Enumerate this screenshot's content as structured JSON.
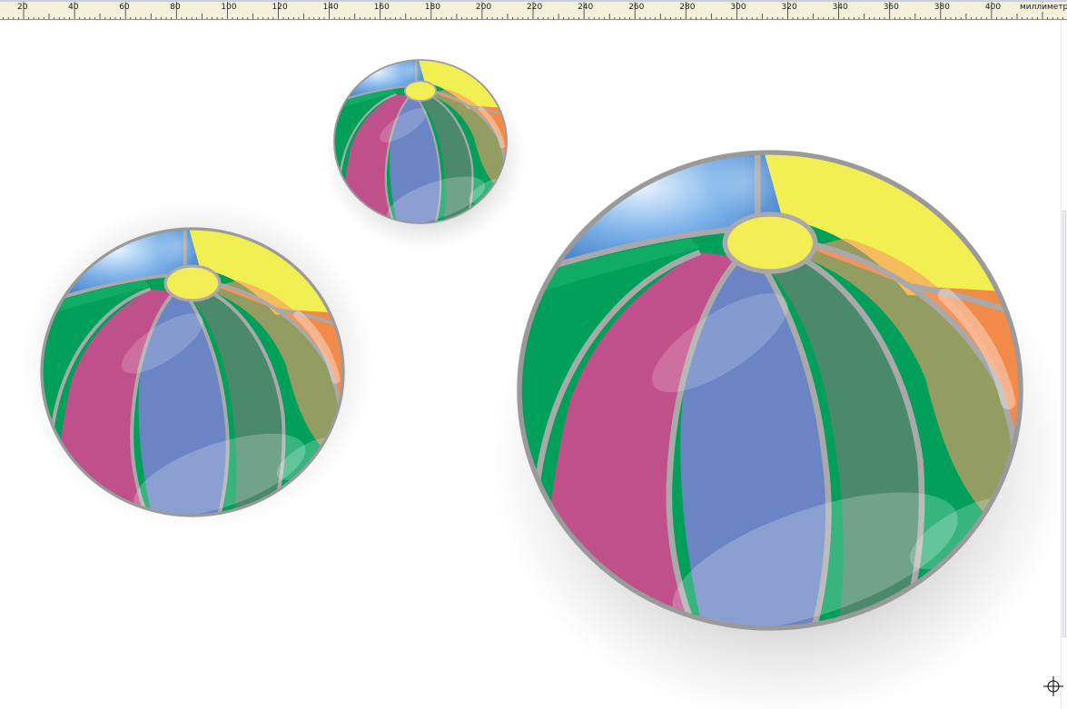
{
  "ruler": {
    "ticks": [
      "20",
      "40",
      "60",
      "80",
      "100",
      "120",
      "140",
      "160",
      "180",
      "200",
      "220",
      "240",
      "260",
      "280",
      "300",
      "320",
      "340",
      "360",
      "380",
      "400"
    ],
    "units": "миллиметр"
  },
  "drawing": {
    "objects": [
      "beach-ball-small",
      "beach-ball-medium",
      "beach-ball-large"
    ],
    "panel_colors": {
      "blue": "#4a90d9",
      "yellow": "#f2ef52",
      "orange": "#f28a4a",
      "green": "#00a05a",
      "magenta": "#c0508a",
      "periwinkle": "#6b84c4",
      "teal": "#4a8a6a",
      "cap": "#f4ee55",
      "seam": "#a9a9a9"
    }
  }
}
